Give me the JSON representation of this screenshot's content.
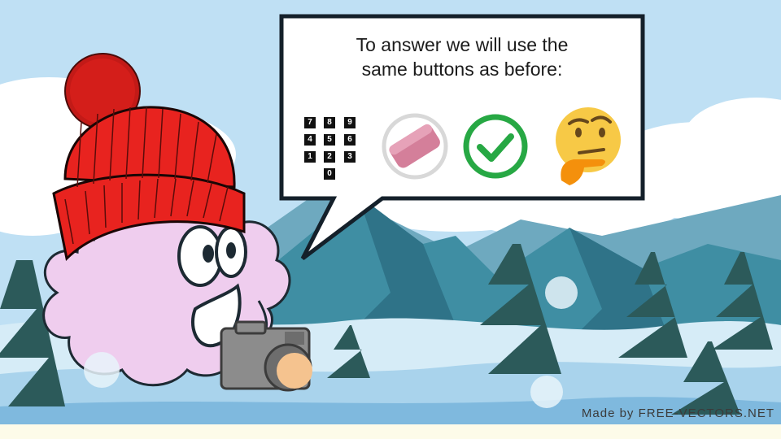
{
  "speech_bubble": {
    "line1": "To answer we will use the",
    "line2": "same buttons as before:"
  },
  "buttons": {
    "numpad_keys": [
      "7",
      "8",
      "9",
      "4",
      "5",
      "6",
      "1",
      "2",
      "3",
      "0"
    ],
    "numpad_icon": "numpad-icon",
    "eraser_icon": "eraser-icon",
    "check_icon": "checkmark-icon",
    "thinking_icon": "thinking-face-icon"
  },
  "credit": "Made by FREE-VECTORS.NET",
  "colors": {
    "sky": "#bfe0f4",
    "mountain": "#3f8ea3",
    "snow": "#d6ecf7",
    "tree": "#2c5a5a",
    "hat": "#e8231f",
    "character": "#efcdee",
    "check": "#27a844",
    "emoji": "#f7c946"
  }
}
